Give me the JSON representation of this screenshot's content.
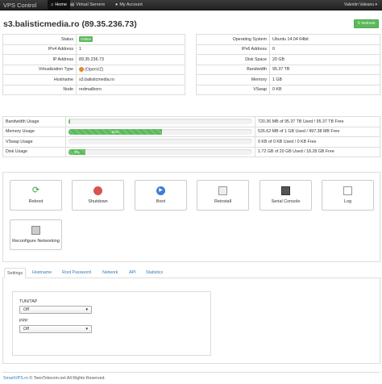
{
  "navbar": {
    "brand": "VPS Control",
    "home": "Home",
    "virtual_servers": "Virtual Servers",
    "my_account": "My Account",
    "user": "Valentin Valeanu ▾"
  },
  "page": {
    "title": "s3.balisticmedia.ro (89.35.236.73)",
    "refresh_label": "Refresh"
  },
  "info_left": [
    {
      "label": "Status",
      "value": "Online"
    },
    {
      "label": "IPv4 Address",
      "value": "1"
    },
    {
      "label": "IP Address",
      "value": "89.35.236.73"
    },
    {
      "label": "Virtualization Type",
      "value": "(OpenVZ)"
    },
    {
      "label": "Hostname",
      "value": "s3.balisticmedia.ro"
    },
    {
      "label": "Node",
      "value": "redmailboro"
    }
  ],
  "info_right": [
    {
      "label": "Operating System",
      "value": "Ubuntu 14.04 64bit"
    },
    {
      "label": "IPv6 Address",
      "value": "0"
    },
    {
      "label": "Disk Space",
      "value": "20 GB"
    },
    {
      "label": "Bandwidth",
      "value": "95.37 TB"
    },
    {
      "label": "Memory",
      "value": "1 GB"
    },
    {
      "label": "VSwap",
      "value": "0 KB"
    }
  ],
  "usage": [
    {
      "label": "Bandwidth Usage",
      "percent": 1,
      "bar_text": "",
      "detail": "720.36 MB of 95.37 TB Used / 95.37 TB Free"
    },
    {
      "label": "Memory Usage",
      "percent": 51,
      "bar_text": "51%",
      "detail": "526.62 MB of 1 GB Used / 497.38 MB Free"
    },
    {
      "label": "VSwap Usage",
      "percent": 0,
      "bar_text": "",
      "detail": "0 KB of 0 KB Used / 0 KB Free"
    },
    {
      "label": "Disk Usage",
      "percent": 9,
      "bar_text": "9%",
      "detail": "1.72 GB of 20 GB Used / 18.28 GB Free"
    }
  ],
  "actions": {
    "reboot": "Reboot",
    "shutdown": "Shutdown",
    "boot": "Boot",
    "reinstall": "Reinstall",
    "serial_console": "Serial Console",
    "log": "Log",
    "reconfigure_networking": "Reconfigure Networking"
  },
  "tabs": [
    "Settings",
    "Hostname",
    "Root Password",
    "Network",
    "API",
    "Statistics"
  ],
  "settings": {
    "tuntap_label": "TUN/TAP",
    "tuntap_value": "Off",
    "ppp_label": "PPP",
    "ppp_value": "Off"
  },
  "footer": {
    "brand_link": "SmartVPS.ro",
    "text": "© TeenTelecom.net All Rights Reserved."
  },
  "colors": {
    "success": "#5cb85c",
    "link": "#337ab7",
    "navbar": "#222222",
    "danger": "#d9534f"
  }
}
